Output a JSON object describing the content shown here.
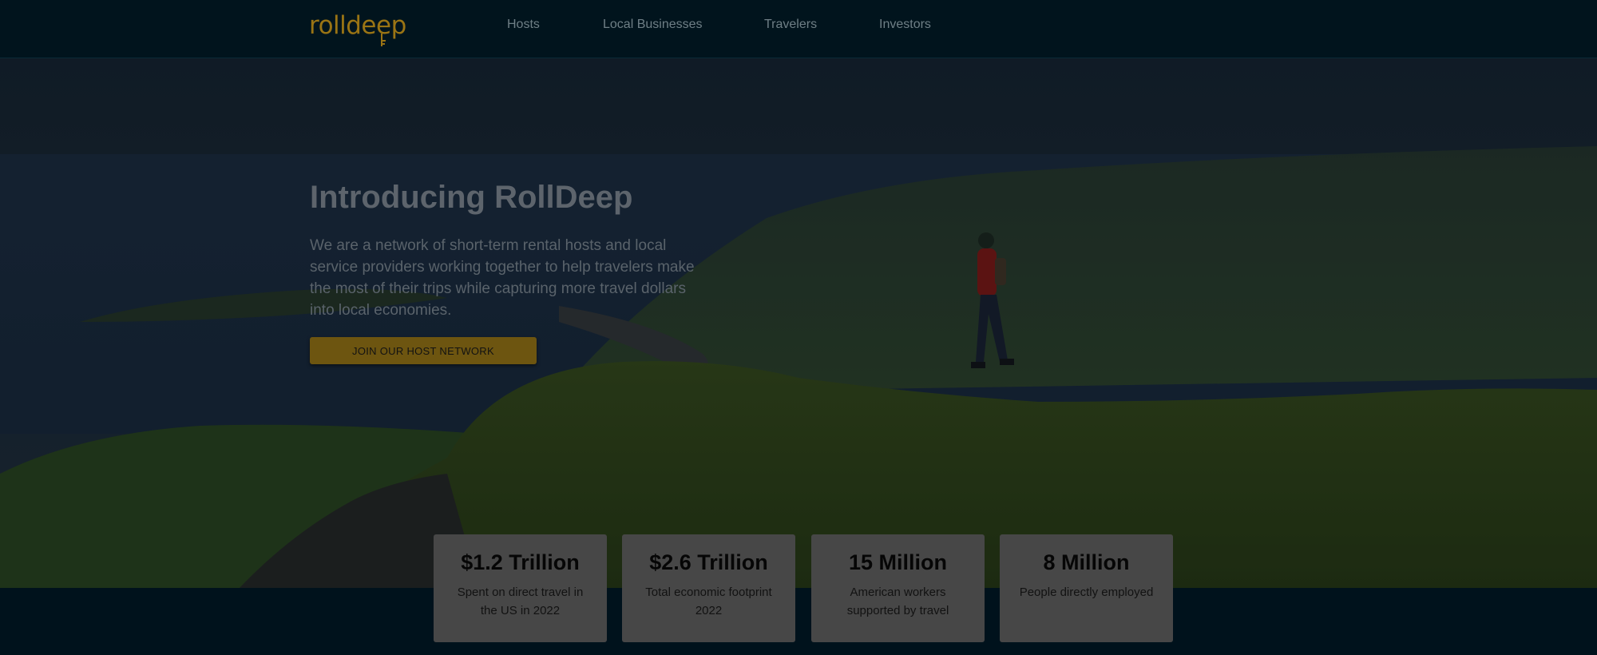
{
  "header": {
    "logo": "rolldeep",
    "nav": [
      {
        "label": "Hosts"
      },
      {
        "label": "Local Businesses"
      },
      {
        "label": "Travelers"
      },
      {
        "label": "Investors"
      }
    ]
  },
  "hero": {
    "title": "Introducing RollDeep",
    "description": "We are a network of short-term rental hosts and local service providers working together to help travelers make the most of their trips while capturing more travel dollars into local economies.",
    "cta_label": "JOIN OUR HOST NETWORK"
  },
  "stats": [
    {
      "value": "$1.2 Trillion",
      "label": "Spent on direct travel in the US in 2022"
    },
    {
      "value": "$2.6 Trillion",
      "label": "Total economic footprint 2022"
    },
    {
      "value": "15 Million",
      "label": "American workers supported by travel"
    },
    {
      "value": "8 Million",
      "label": "People directly employed"
    }
  ],
  "colors": {
    "header_bg": "#01141d",
    "accent": "#9a7414",
    "card_bg": "#474747"
  }
}
